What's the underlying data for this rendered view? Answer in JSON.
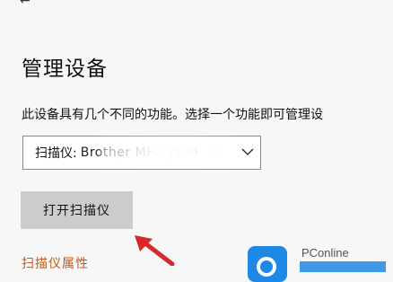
{
  "page": {
    "title": "管理设备",
    "description": "此设备具有几个不同的功能。选择一个功能即可管理设"
  },
  "device_select": {
    "label": "扫描仪:",
    "value": "Brother MFC-J900"
  },
  "buttons": {
    "open_scanner": "打开扫描仪"
  },
  "links": {
    "scanner_properties": "扫描仪属性"
  },
  "watermark": {
    "brand": "PConline"
  },
  "colors": {
    "button_bg": "#cccccc",
    "link": "#c15b1a",
    "arrow": "#d42a2a",
    "logo": "#1e88e5"
  }
}
